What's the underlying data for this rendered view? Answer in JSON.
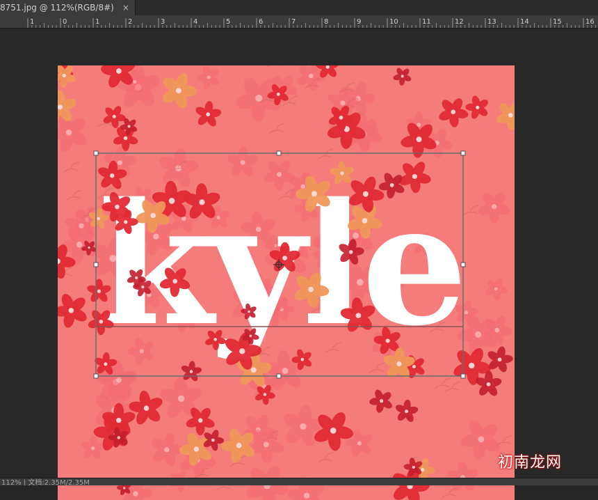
{
  "tab": {
    "label": "8751.jpg @ 112%(RGB/8#)",
    "close_glyph": "×"
  },
  "ruler": {
    "labels": [
      "1",
      "0",
      "1",
      "2",
      "3",
      "4",
      "5",
      "6",
      "7",
      "8",
      "9",
      "10",
      "11",
      "12",
      "13",
      "14",
      "15",
      "16"
    ]
  },
  "document": {
    "text_layer": "kyle",
    "background_color": "#f47c7a",
    "text_color": "#ffffff",
    "flower_colors": [
      "#e22a35",
      "#f0975a",
      "#f56a74",
      "#c41e2e"
    ],
    "layer_mode_icon": "move-crosshair-icon"
  },
  "status": {
    "text": "112% | 文档:2.35M/2.35M"
  },
  "watermark": {
    "text": "初南龙网"
  }
}
